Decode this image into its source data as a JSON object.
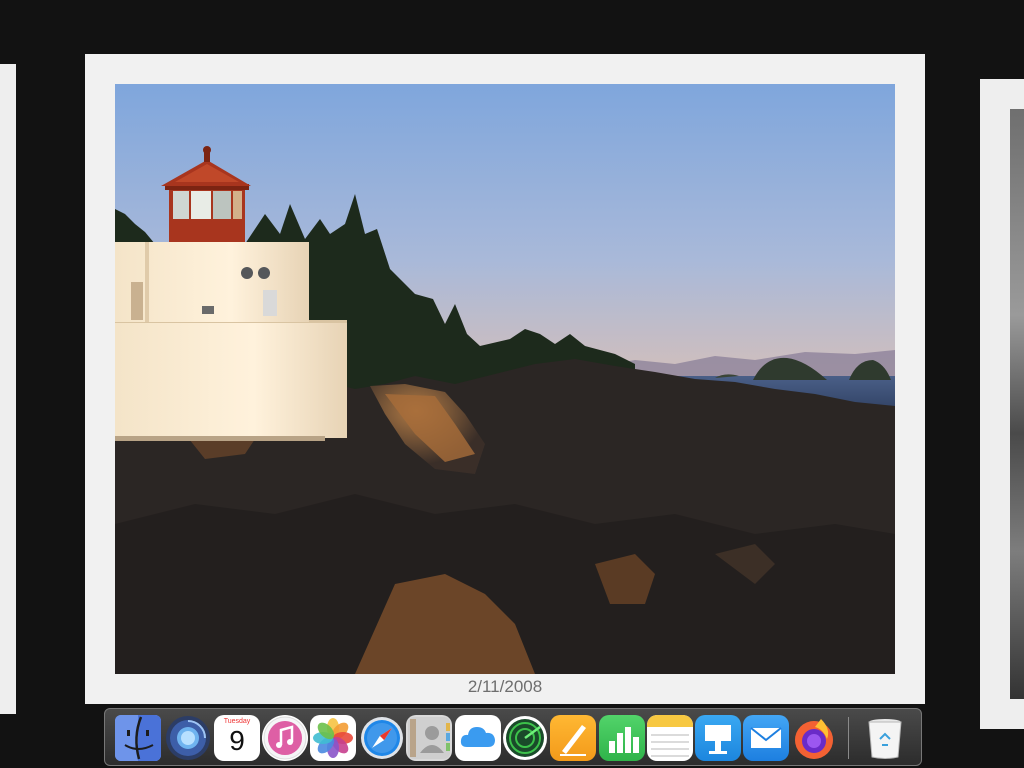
{
  "photo_card": {
    "date": "2/11/2008",
    "subject": "lighthouse-on-rocky-coast"
  },
  "dock": {
    "apps": [
      {
        "name": "Finder",
        "icon": "finder-icon"
      },
      {
        "name": "Launchpad",
        "icon": "launchpad-icon"
      },
      {
        "name": "Calendar",
        "icon": "calendar-icon",
        "day_label": "Tuesday",
        "day_number": "9"
      },
      {
        "name": "Music",
        "icon": "music-icon"
      },
      {
        "name": "Photos",
        "icon": "photos-icon"
      },
      {
        "name": "Safari",
        "icon": "safari-icon"
      },
      {
        "name": "Contacts",
        "icon": "contacts-icon"
      },
      {
        "name": "iCloud",
        "icon": "icloud-icon"
      },
      {
        "name": "Find My",
        "icon": "radar-icon"
      },
      {
        "name": "Pages",
        "icon": "pages-icon"
      },
      {
        "name": "Numbers",
        "icon": "numbers-icon"
      },
      {
        "name": "Notes",
        "icon": "notes-icon"
      },
      {
        "name": "Keynote",
        "icon": "keynote-icon"
      },
      {
        "name": "Mail",
        "icon": "mail-icon"
      },
      {
        "name": "Firefox",
        "icon": "firefox-icon"
      },
      {
        "name": "Trash",
        "icon": "trash-icon"
      }
    ]
  },
  "colors": {
    "background": "#121212",
    "card": "#f1f1f1",
    "date_text": "#6e6e6e"
  }
}
